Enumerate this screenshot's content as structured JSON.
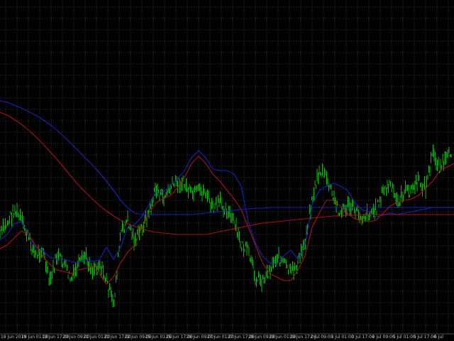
{
  "chart": {
    "background": "#000000",
    "grid_color": "#8a8a8a",
    "candle_color": "#00c000",
    "ma_fast_color": "#1428c8",
    "ma_slow_color": "#b01414"
  },
  "chart_data": {
    "type": "line",
    "x_tick_labels": [
      "18 Jun 2019",
      "19 Jun 01:00",
      "19 Jun 17:00",
      "20 Jun 09:00",
      "21 Jun 01:00",
      "21 Jun 17:00",
      "22 Jun 09:00",
      "25 Jun 01:00",
      "25 Jun 17:00",
      "26 Jun 09:00",
      "27 Jun 01:00",
      "27 Jun 17:00",
      "28 Jun 09:00",
      "29 Jun 01:00",
      "29 Jun 17:00",
      "2 Jul 09:00",
      "3 Jul 01:00",
      "3 Jul 17:00",
      "4 Jul 09:00",
      "5 Jul 01:00",
      "5 Jul 17:00",
      "6 Jul"
    ],
    "x": [
      0,
      10,
      20,
      30,
      40,
      50,
      60,
      70,
      80,
      90,
      100,
      110,
      120,
      130,
      140,
      150,
      160,
      170,
      180,
      190,
      200,
      210,
      220,
      230,
      240,
      250,
      260,
      270,
      280,
      290,
      300,
      310,
      320,
      330,
      340,
      350,
      360,
      370,
      380,
      390,
      400,
      410,
      420,
      430,
      440,
      450,
      460,
      470,
      480,
      490,
      500,
      510,
      520,
      530,
      540,
      550,
      560,
      570,
      580,
      590,
      600,
      610,
      620,
      630,
      640
    ],
    "series": [
      {
        "name": "",
        "role": "price",
        "values": [
          330,
          315,
          295,
          310,
          335,
          360,
          350,
          400,
          360,
          370,
          395,
          375,
          360,
          380,
          370,
          395,
          430,
          330,
          310,
          340,
          320,
          300,
          265,
          280,
          265,
          255,
          260,
          275,
          270,
          270,
          295,
          285,
          295,
          315,
          345,
          355,
          390,
          395,
          380,
          360,
          370,
          385,
          370,
          340,
          280,
          240,
          250,
          280,
          300,
          290,
          295,
          305,
          300,
          295,
          270,
          260,
          285,
          270,
          268,
          255,
          265,
          215,
          235,
          225,
          205
        ]
      },
      {
        "name": "",
        "role": "ma-fast",
        "values": [
          338,
          330,
          315,
          312,
          330,
          348,
          352,
          362,
          365,
          365,
          368,
          370,
          365,
          368,
          366,
          348,
          365,
          348,
          320,
          316,
          305,
          288,
          270,
          270,
          262,
          252,
          240,
          222,
          212,
          222,
          238,
          240,
          240,
          245,
          262,
          312,
          342,
          360,
          370,
          372,
          360,
          352,
          365,
          345,
          288,
          268,
          262,
          258,
          262,
          268,
          285,
          295,
          298,
          305,
          303,
          300,
          302,
          300,
          298,
          296,
          294,
          292,
          292,
          292,
          292
        ]
      },
      {
        "name": "",
        "role": "ma-slow",
        "values": [
          350,
          345,
          335,
          325,
          330,
          345,
          360,
          372,
          380,
          382,
          385,
          380,
          378,
          375,
          385,
          400,
          390,
          370,
          355,
          345,
          320,
          300,
          285,
          280,
          275,
          265,
          250,
          230,
          220,
          230,
          245,
          255,
          268,
          280,
          295,
          320,
          345,
          370,
          385,
          390,
          395,
          395,
          380,
          360,
          320,
          300,
          282,
          282,
          290,
          300,
          308,
          310,
          312,
          310,
          300,
          290,
          285,
          282,
          280,
          275,
          265,
          255,
          240,
          235,
          230
        ]
      },
      {
        "name": "",
        "role": "ma-long-blue",
        "values": [
          142,
          144,
          148,
          152,
          157,
          162,
          168,
          175,
          183,
          192,
          202,
          212,
          222,
          232,
          243,
          255,
          268,
          282,
          293,
          300,
          302,
          302,
          302,
          302,
          302,
          302,
          302,
          302,
          301,
          300,
          299,
          298,
          297,
          296,
          295,
          294,
          293,
          293,
          292,
          292,
          292,
          292,
          292,
          292,
          292,
          292,
          292,
          292,
          292,
          292,
          292,
          292,
          292,
          292,
          292,
          292,
          292,
          292,
          292,
          292,
          292,
          292,
          292,
          292,
          292
        ]
      },
      {
        "name": "",
        "role": "ma-long-red",
        "values": [
          158,
          162,
          168,
          175,
          183,
          192,
          202,
          213,
          224,
          236,
          248,
          260,
          270,
          280,
          289,
          297,
          304,
          310,
          315,
          319,
          322,
          325,
          327,
          328,
          329,
          330,
          330,
          330,
          330,
          330,
          328,
          326,
          324,
          322,
          320,
          318,
          316,
          314,
          313,
          312,
          311,
          310,
          309,
          308,
          307,
          306,
          305,
          304,
          304,
          303,
          303,
          302,
          302,
          302,
          302,
          302,
          302,
          302,
          302,
          302,
          302,
          302,
          302,
          302,
          302
        ]
      }
    ],
    "ylim": [
      480,
      0
    ],
    "grid": true,
    "legend": "none"
  }
}
